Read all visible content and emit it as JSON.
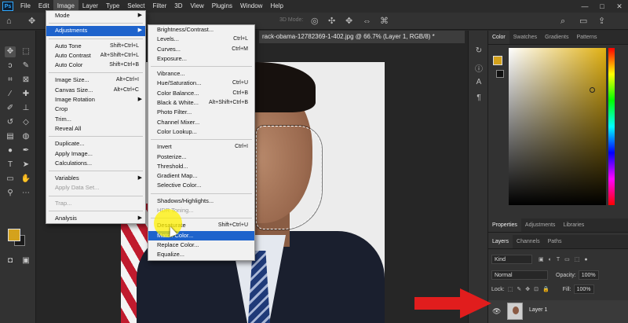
{
  "menubar": {
    "logo": "Ps",
    "items": [
      "File",
      "Edit",
      "Image",
      "Layer",
      "Type",
      "Select",
      "Filter",
      "3D",
      "View",
      "Plugins",
      "Window",
      "Help"
    ],
    "active_index": 2
  },
  "options_bar": {
    "mode_3d": "3D Mode:"
  },
  "document": {
    "tab_title": "rack-obama-12782369-1-402.jpg @ 66.7% (Layer 1, RGB/8) *"
  },
  "image_menu": {
    "items": [
      {
        "label": "Mode",
        "shortcut": "",
        "submenu": true,
        "disabled": false,
        "highlighted": false
      },
      {
        "sep": true
      },
      {
        "label": "Adjustments",
        "shortcut": "",
        "submenu": true,
        "disabled": false,
        "highlighted": true
      },
      {
        "sep": true
      },
      {
        "label": "Auto Tone",
        "shortcut": "Shift+Ctrl+L",
        "submenu": false,
        "disabled": false,
        "highlighted": false
      },
      {
        "label": "Auto Contrast",
        "shortcut": "Alt+Shift+Ctrl+L",
        "submenu": false,
        "disabled": false,
        "highlighted": false
      },
      {
        "label": "Auto Color",
        "shortcut": "Shift+Ctrl+B",
        "submenu": false,
        "disabled": false,
        "highlighted": false
      },
      {
        "sep": true
      },
      {
        "label": "Image Size...",
        "shortcut": "Alt+Ctrl+I",
        "submenu": false,
        "disabled": false,
        "highlighted": false
      },
      {
        "label": "Canvas Size...",
        "shortcut": "Alt+Ctrl+C",
        "submenu": false,
        "disabled": false,
        "highlighted": false
      },
      {
        "label": "Image Rotation",
        "shortcut": "",
        "submenu": true,
        "disabled": false,
        "highlighted": false
      },
      {
        "label": "Crop",
        "shortcut": "",
        "submenu": false,
        "disabled": false,
        "highlighted": false
      },
      {
        "label": "Trim...",
        "shortcut": "",
        "submenu": false,
        "disabled": false,
        "highlighted": false
      },
      {
        "label": "Reveal All",
        "shortcut": "",
        "submenu": false,
        "disabled": false,
        "highlighted": false
      },
      {
        "sep": true
      },
      {
        "label": "Duplicate...",
        "shortcut": "",
        "submenu": false,
        "disabled": false,
        "highlighted": false
      },
      {
        "label": "Apply Image...",
        "shortcut": "",
        "submenu": false,
        "disabled": false,
        "highlighted": false
      },
      {
        "label": "Calculations...",
        "shortcut": "",
        "submenu": false,
        "disabled": false,
        "highlighted": false
      },
      {
        "sep": true
      },
      {
        "label": "Variables",
        "shortcut": "",
        "submenu": true,
        "disabled": false,
        "highlighted": false
      },
      {
        "label": "Apply Data Set...",
        "shortcut": "",
        "submenu": false,
        "disabled": true,
        "highlighted": false
      },
      {
        "sep": true
      },
      {
        "label": "Trap...",
        "shortcut": "",
        "submenu": false,
        "disabled": true,
        "highlighted": false
      },
      {
        "sep": true
      },
      {
        "label": "Analysis",
        "shortcut": "",
        "submenu": true,
        "disabled": false,
        "highlighted": false
      }
    ]
  },
  "adjustments_menu": {
    "items": [
      {
        "label": "Brightness/Contrast...",
        "shortcut": "",
        "disabled": false,
        "highlighted": false
      },
      {
        "label": "Levels...",
        "shortcut": "Ctrl+L",
        "disabled": false,
        "highlighted": false
      },
      {
        "label": "Curves...",
        "shortcut": "Ctrl+M",
        "disabled": false,
        "highlighted": false
      },
      {
        "label": "Exposure...",
        "shortcut": "",
        "disabled": false,
        "highlighted": false
      },
      {
        "sep": true
      },
      {
        "label": "Vibrance...",
        "shortcut": "",
        "disabled": false,
        "highlighted": false
      },
      {
        "label": "Hue/Saturation...",
        "shortcut": "Ctrl+U",
        "disabled": false,
        "highlighted": false
      },
      {
        "label": "Color Balance...",
        "shortcut": "Ctrl+B",
        "disabled": false,
        "highlighted": false
      },
      {
        "label": "Black & White...",
        "shortcut": "Alt+Shift+Ctrl+B",
        "disabled": false,
        "highlighted": false
      },
      {
        "label": "Photo Filter...",
        "shortcut": "",
        "disabled": false,
        "highlighted": false
      },
      {
        "label": "Channel Mixer...",
        "shortcut": "",
        "disabled": false,
        "highlighted": false
      },
      {
        "label": "Color Lookup...",
        "shortcut": "",
        "disabled": false,
        "highlighted": false
      },
      {
        "sep": true
      },
      {
        "label": "Invert",
        "shortcut": "Ctrl+I",
        "disabled": false,
        "highlighted": false
      },
      {
        "label": "Posterize...",
        "shortcut": "",
        "disabled": false,
        "highlighted": false
      },
      {
        "label": "Threshold...",
        "shortcut": "",
        "disabled": false,
        "highlighted": false
      },
      {
        "label": "Gradient Map...",
        "shortcut": "",
        "disabled": false,
        "highlighted": false
      },
      {
        "label": "Selective Color...",
        "shortcut": "",
        "disabled": false,
        "highlighted": false
      },
      {
        "sep": true
      },
      {
        "label": "Shadows/Highlights...",
        "shortcut": "",
        "disabled": false,
        "highlighted": false
      },
      {
        "label": "HDR Toning...",
        "shortcut": "",
        "disabled": true,
        "highlighted": false
      },
      {
        "sep": true
      },
      {
        "label": "Desaturate",
        "shortcut": "Shift+Ctrl+U",
        "disabled": false,
        "highlighted": false
      },
      {
        "label": "Match Color...",
        "shortcut": "",
        "disabled": false,
        "highlighted": true
      },
      {
        "label": "Replace Color...",
        "shortcut": "",
        "disabled": false,
        "highlighted": false
      },
      {
        "label": "Equalize...",
        "shortcut": "",
        "disabled": false,
        "highlighted": false
      }
    ]
  },
  "color_panel": {
    "tabs": [
      "Color",
      "Swatches",
      "Gradients",
      "Patterns"
    ],
    "foreground": "#d4a21c",
    "background": "#111111"
  },
  "properties_panel": {
    "tabs": [
      "Properties",
      "Adjustments",
      "Libraries"
    ]
  },
  "layers_panel": {
    "tabs": [
      "Layers",
      "Channels",
      "Paths"
    ],
    "kind": "Kind",
    "blend_mode": "Normal",
    "opacity_label": "Opacity:",
    "opacity_value": "100%",
    "lock_label": "Lock:",
    "fill_label": "Fill:",
    "fill_value": "100%",
    "layer_name": "Layer 1"
  },
  "colors": {
    "accent": "#1e63cc",
    "arrow": "#e11d1d",
    "highlighter": "#fff000"
  }
}
